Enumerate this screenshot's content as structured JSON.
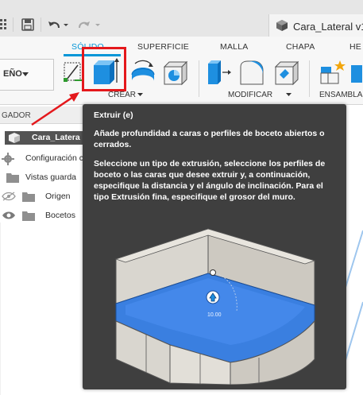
{
  "window": {
    "document_title": "Cara_Lateral v1"
  },
  "toolbar": {
    "icons": [
      "grid-icon",
      "save-icon",
      "undo-icon",
      "undo-dropdown-icon",
      "redo-icon",
      "redo-dropdown-icon",
      "document-cube-icon"
    ]
  },
  "ribbon": {
    "workspace_label": "EÑO",
    "tabs": [
      {
        "label": "SÓLIDO",
        "active": true
      },
      {
        "label": "SUPERFICIE",
        "active": false
      },
      {
        "label": "MALLA",
        "active": false
      },
      {
        "label": "CHAPA",
        "active": false
      },
      {
        "label": "HE",
        "active": false
      }
    ],
    "groups": {
      "create": "CREAR",
      "modify": "MODIFICAR",
      "assemble": "ENSAMBLA"
    }
  },
  "browser": {
    "header": "GADOR",
    "root": "Cara_Latera",
    "items": [
      {
        "label": "Configuración c"
      },
      {
        "label": "Vistas guarda"
      },
      {
        "label": "Origen"
      },
      {
        "label": "Bocetos"
      }
    ]
  },
  "tooltip": {
    "title": "Extruir (e)",
    "paragraph1": "Añade profundidad a caras o perfiles de boceto abiertos o cerrados.",
    "paragraph2": "Seleccione un tipo de extrusión, seleccione los perfiles de boceto o las caras que desee extruir y, a continuación, especifique la distancia y el ángulo de inclinación. Para el tipo Extrusión fina, especifique el grosor del muro.",
    "illustration_value": "10.00"
  },
  "colors": {
    "accent": "#0696d7",
    "highlight_red": "#e4181c",
    "tooltip_bg": "#3f3f3f",
    "extrude_blue": "#3a7fe0"
  }
}
